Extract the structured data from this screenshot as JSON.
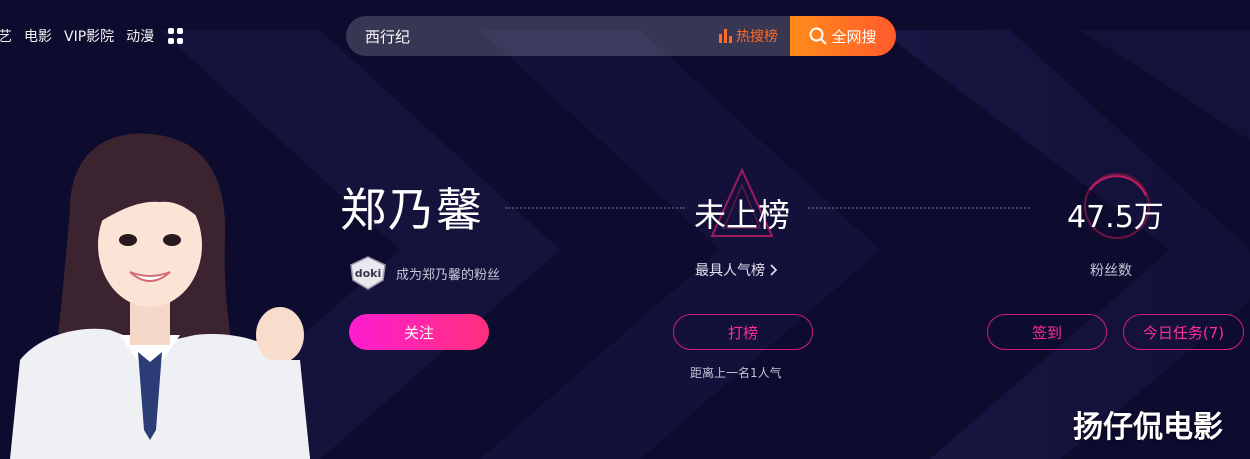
{
  "nav": {
    "items": [
      "艺",
      "电影",
      "VIP影院",
      "动漫"
    ]
  },
  "search": {
    "value": "西行纪",
    "hot_label": "热搜榜",
    "button_label": "全网搜"
  },
  "star": {
    "name": "郑乃馨",
    "doki_badge": "doki",
    "doki_text": "成为郑乃馨的粉丝",
    "follow_label": "关注"
  },
  "rank": {
    "value": "未上榜",
    "link_label": "最具人气榜",
    "button_label": "打榜",
    "note": "距离上一名1人气"
  },
  "fans": {
    "count": "47.5万",
    "label": "粉丝数",
    "signin_label": "签到",
    "task_label": "今日任务(7)"
  },
  "watermark": "扬仔侃电影",
  "colors": {
    "background": "#0d0b2e",
    "accent_pink": "#ff2d9a",
    "search_orange": "#ff6a26"
  },
  "icons": [
    "grid-icon",
    "hot-bars-icon",
    "search-icon",
    "doki-badge-icon",
    "chevron-right-icon"
  ]
}
